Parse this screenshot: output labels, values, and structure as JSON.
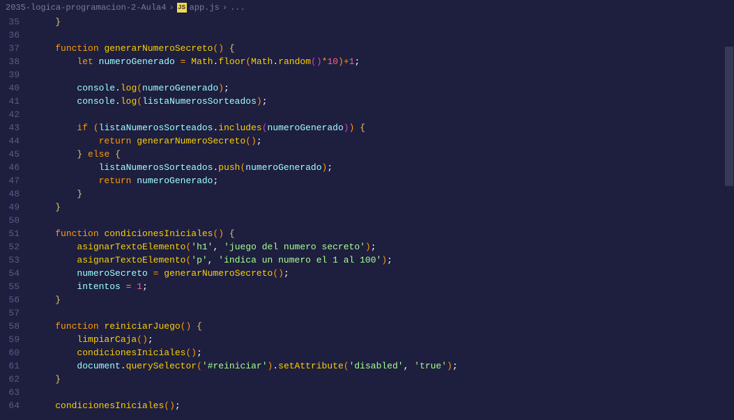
{
  "breadcrumb": {
    "folder": "2035-logica-programacion-2-Aula4",
    "file": "app.js",
    "ellipsis": "..."
  },
  "icons": {
    "js": "JS"
  },
  "lineStart": 35,
  "lineEnd": 64,
  "code": {
    "l35": {
      "indent": "    ",
      "tokens": [
        {
          "c": "br",
          "t": "}"
        }
      ]
    },
    "l36": {
      "indent": "",
      "tokens": []
    },
    "l37": {
      "indent": "    ",
      "tokens": [
        {
          "c": "kw",
          "t": "function"
        },
        {
          "c": "",
          "t": " "
        },
        {
          "c": "fn",
          "t": "generarNumeroSecreto"
        },
        {
          "c": "par",
          "t": "("
        },
        {
          "c": "par",
          "t": ")"
        },
        {
          "c": "",
          "t": " "
        },
        {
          "c": "br",
          "t": "{"
        }
      ]
    },
    "l38": {
      "indent": "        ",
      "tokens": [
        {
          "c": "kw",
          "t": "let"
        },
        {
          "c": "",
          "t": " "
        },
        {
          "c": "var",
          "t": "numeroGenerado"
        },
        {
          "c": "",
          "t": " "
        },
        {
          "c": "op",
          "t": "="
        },
        {
          "c": "",
          "t": " "
        },
        {
          "c": "obj",
          "t": "Math"
        },
        {
          "c": "punc",
          "t": "."
        },
        {
          "c": "fn",
          "t": "floor"
        },
        {
          "c": "par",
          "t": "("
        },
        {
          "c": "obj",
          "t": "Math"
        },
        {
          "c": "punc",
          "t": "."
        },
        {
          "c": "fn",
          "t": "random"
        },
        {
          "c": "par2",
          "t": "("
        },
        {
          "c": "par2",
          "t": ")"
        },
        {
          "c": "op",
          "t": "*"
        },
        {
          "c": "num",
          "t": "10"
        },
        {
          "c": "par",
          "t": ")"
        },
        {
          "c": "op",
          "t": "+"
        },
        {
          "c": "num",
          "t": "1"
        },
        {
          "c": "punc",
          "t": ";"
        }
      ]
    },
    "l39": {
      "indent": "",
      "tokens": []
    },
    "l40": {
      "indent": "        ",
      "tokens": [
        {
          "c": "var",
          "t": "console"
        },
        {
          "c": "punc",
          "t": "."
        },
        {
          "c": "fn",
          "t": "log"
        },
        {
          "c": "par",
          "t": "("
        },
        {
          "c": "var",
          "t": "numeroGenerado"
        },
        {
          "c": "par",
          "t": ")"
        },
        {
          "c": "punc",
          "t": ";"
        }
      ]
    },
    "l41": {
      "indent": "        ",
      "tokens": [
        {
          "c": "var",
          "t": "console"
        },
        {
          "c": "punc",
          "t": "."
        },
        {
          "c": "fn",
          "t": "log"
        },
        {
          "c": "par",
          "t": "("
        },
        {
          "c": "var",
          "t": "listaNumerosSorteados"
        },
        {
          "c": "par",
          "t": ")"
        },
        {
          "c": "punc",
          "t": ";"
        }
      ]
    },
    "l42": {
      "indent": "",
      "tokens": []
    },
    "l43": {
      "indent": "        ",
      "tokens": [
        {
          "c": "kw",
          "t": "if"
        },
        {
          "c": "",
          "t": " "
        },
        {
          "c": "par",
          "t": "("
        },
        {
          "c": "var",
          "t": "listaNumerosSorteados"
        },
        {
          "c": "punc",
          "t": "."
        },
        {
          "c": "fn",
          "t": "includes"
        },
        {
          "c": "par2",
          "t": "("
        },
        {
          "c": "var",
          "t": "numeroGenerado"
        },
        {
          "c": "par2",
          "t": ")"
        },
        {
          "c": "par",
          "t": ")"
        },
        {
          "c": "",
          "t": " "
        },
        {
          "c": "br",
          "t": "{"
        }
      ]
    },
    "l44": {
      "indent": "            ",
      "tokens": [
        {
          "c": "kw",
          "t": "return"
        },
        {
          "c": "",
          "t": " "
        },
        {
          "c": "fn",
          "t": "generarNumeroSecreto"
        },
        {
          "c": "par",
          "t": "("
        },
        {
          "c": "par",
          "t": ")"
        },
        {
          "c": "punc",
          "t": ";"
        }
      ]
    },
    "l45": {
      "indent": "        ",
      "tokens": [
        {
          "c": "br",
          "t": "}"
        },
        {
          "c": "",
          "t": " "
        },
        {
          "c": "kw",
          "t": "else"
        },
        {
          "c": "",
          "t": " "
        },
        {
          "c": "br",
          "t": "{"
        }
      ]
    },
    "l46": {
      "indent": "            ",
      "tokens": [
        {
          "c": "var",
          "t": "listaNumerosSorteados"
        },
        {
          "c": "punc",
          "t": "."
        },
        {
          "c": "fn",
          "t": "push"
        },
        {
          "c": "par",
          "t": "("
        },
        {
          "c": "var",
          "t": "numeroGenerado"
        },
        {
          "c": "par",
          "t": ")"
        },
        {
          "c": "punc",
          "t": ";"
        }
      ]
    },
    "l47": {
      "indent": "            ",
      "tokens": [
        {
          "c": "kw",
          "t": "return"
        },
        {
          "c": "",
          "t": " "
        },
        {
          "c": "var",
          "t": "numeroGenerado"
        },
        {
          "c": "punc",
          "t": ";"
        }
      ]
    },
    "l48": {
      "indent": "        ",
      "tokens": [
        {
          "c": "br",
          "t": "}"
        }
      ]
    },
    "l49": {
      "indent": "    ",
      "tokens": [
        {
          "c": "br",
          "t": "}"
        }
      ]
    },
    "l50": {
      "indent": "",
      "tokens": []
    },
    "l51": {
      "indent": "    ",
      "tokens": [
        {
          "c": "kw",
          "t": "function"
        },
        {
          "c": "",
          "t": " "
        },
        {
          "c": "fn",
          "t": "condicionesIniciales"
        },
        {
          "c": "par",
          "t": "("
        },
        {
          "c": "par",
          "t": ")"
        },
        {
          "c": "",
          "t": " "
        },
        {
          "c": "br",
          "t": "{"
        }
      ]
    },
    "l52": {
      "indent": "        ",
      "tokens": [
        {
          "c": "fn",
          "t": "asignarTextoElemento"
        },
        {
          "c": "par",
          "t": "("
        },
        {
          "c": "str",
          "t": "'h1'"
        },
        {
          "c": "punc",
          "t": ","
        },
        {
          "c": "",
          "t": " "
        },
        {
          "c": "str",
          "t": "'juego del numero secreto'"
        },
        {
          "c": "par",
          "t": ")"
        },
        {
          "c": "punc",
          "t": ";"
        }
      ]
    },
    "l53": {
      "indent": "        ",
      "tokens": [
        {
          "c": "fn",
          "t": "asignarTextoElemento"
        },
        {
          "c": "par",
          "t": "("
        },
        {
          "c": "str",
          "t": "'p'"
        },
        {
          "c": "punc",
          "t": ","
        },
        {
          "c": "",
          "t": " "
        },
        {
          "c": "str",
          "t": "'indica un numero el 1 al 100'"
        },
        {
          "c": "par",
          "t": ")"
        },
        {
          "c": "punc",
          "t": ";"
        }
      ]
    },
    "l54": {
      "indent": "        ",
      "tokens": [
        {
          "c": "var",
          "t": "numeroSecreto"
        },
        {
          "c": "",
          "t": " "
        },
        {
          "c": "op",
          "t": "="
        },
        {
          "c": "",
          "t": " "
        },
        {
          "c": "fn",
          "t": "generarNumeroSecreto"
        },
        {
          "c": "par",
          "t": "("
        },
        {
          "c": "par",
          "t": ")"
        },
        {
          "c": "punc",
          "t": ";"
        }
      ]
    },
    "l55": {
      "indent": "        ",
      "tokens": [
        {
          "c": "var",
          "t": "intentos"
        },
        {
          "c": "",
          "t": " "
        },
        {
          "c": "op",
          "t": "="
        },
        {
          "c": "",
          "t": " "
        },
        {
          "c": "num",
          "t": "1"
        },
        {
          "c": "punc",
          "t": ";"
        }
      ]
    },
    "l56": {
      "indent": "    ",
      "tokens": [
        {
          "c": "br",
          "t": "}"
        }
      ]
    },
    "l57": {
      "indent": "",
      "tokens": []
    },
    "l58": {
      "indent": "    ",
      "tokens": [
        {
          "c": "kw",
          "t": "function"
        },
        {
          "c": "",
          "t": " "
        },
        {
          "c": "fn",
          "t": "reiniciarJuego"
        },
        {
          "c": "par",
          "t": "("
        },
        {
          "c": "par",
          "t": ")"
        },
        {
          "c": "",
          "t": " "
        },
        {
          "c": "br",
          "t": "{"
        }
      ]
    },
    "l59": {
      "indent": "        ",
      "tokens": [
        {
          "c": "fn",
          "t": "limpiarCaja"
        },
        {
          "c": "par",
          "t": "("
        },
        {
          "c": "par",
          "t": ")"
        },
        {
          "c": "punc",
          "t": ";"
        }
      ]
    },
    "l60": {
      "indent": "        ",
      "tokens": [
        {
          "c": "fn",
          "t": "condicionesIniciales"
        },
        {
          "c": "par",
          "t": "("
        },
        {
          "c": "par",
          "t": ")"
        },
        {
          "c": "punc",
          "t": ";"
        }
      ]
    },
    "l61": {
      "indent": "        ",
      "tokens": [
        {
          "c": "var",
          "t": "document"
        },
        {
          "c": "punc",
          "t": "."
        },
        {
          "c": "fn",
          "t": "querySelector"
        },
        {
          "c": "par",
          "t": "("
        },
        {
          "c": "str",
          "t": "'#reiniciar'"
        },
        {
          "c": "par",
          "t": ")"
        },
        {
          "c": "punc",
          "t": "."
        },
        {
          "c": "fn",
          "t": "setAttribute"
        },
        {
          "c": "par",
          "t": "("
        },
        {
          "c": "str",
          "t": "'disabled'"
        },
        {
          "c": "punc",
          "t": ","
        },
        {
          "c": "",
          "t": " "
        },
        {
          "c": "str",
          "t": "'true'"
        },
        {
          "c": "par",
          "t": ")"
        },
        {
          "c": "punc",
          "t": ";"
        }
      ]
    },
    "l62": {
      "indent": "    ",
      "tokens": [
        {
          "c": "br",
          "t": "}"
        }
      ]
    },
    "l63": {
      "indent": "",
      "tokens": []
    },
    "l64": {
      "indent": "    ",
      "tokens": [
        {
          "c": "fn",
          "t": "condicionesIniciales"
        },
        {
          "c": "par",
          "t": "("
        },
        {
          "c": "par",
          "t": ")"
        },
        {
          "c": "punc",
          "t": ";"
        }
      ]
    }
  }
}
